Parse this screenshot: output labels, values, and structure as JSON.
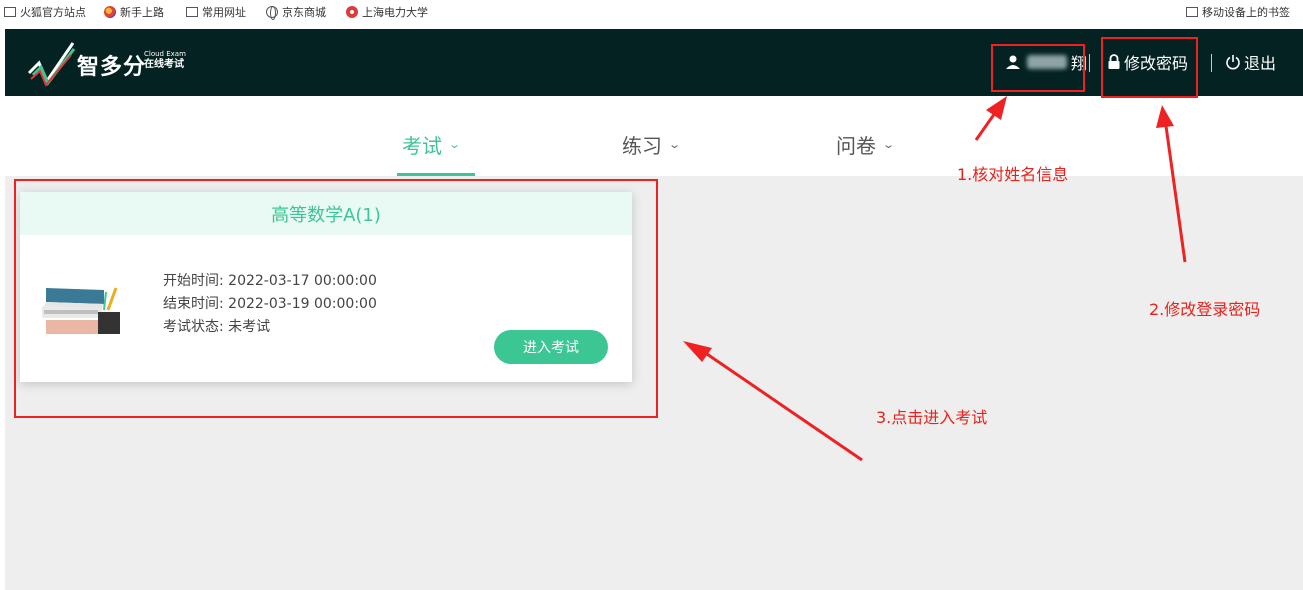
{
  "bookmarks": [
    {
      "label": "火狐官方站点",
      "icon": "folder-icon"
    },
    {
      "label": "新手上路",
      "icon": "firefox-icon"
    },
    {
      "label": "常用网址",
      "icon": "folder-icon"
    },
    {
      "label": "京东商城",
      "icon": "globe-icon"
    },
    {
      "label": "上海电力大学",
      "icon": "university-icon"
    }
  ],
  "mobile_bookmarks": "移动设备上的书签",
  "header": {
    "logo_text": "智多分",
    "logo_sub_en": "Cloud Exam",
    "logo_sub_cn": "在线考试",
    "user_name_visible": "翔",
    "change_password": "修改密码",
    "logout": "退出"
  },
  "nav": {
    "tabs": [
      {
        "label": "考试",
        "active": true
      },
      {
        "label": "练习",
        "active": false
      },
      {
        "label": "问卷",
        "active": false
      }
    ]
  },
  "exam_card": {
    "title": "高等数学A(1)",
    "start_label": "开始时间:",
    "start_time": "2022-03-17 00:00:00",
    "end_label": "结束时间:",
    "end_time": "2022-03-19 00:00:00",
    "status_label": "考试状态:",
    "status": "未考试",
    "enter_button": "进入考试"
  },
  "annotations": {
    "step1": "1.核对姓名信息",
    "step2": "2.修改登录密码",
    "step3": "3.点击进入考试"
  },
  "colors": {
    "header_bg": "#032221",
    "accent": "#3cc694",
    "card_head_bg": "#e9f9f4",
    "content_bg": "#eeeeee",
    "annotation_red": "#e8221c"
  }
}
